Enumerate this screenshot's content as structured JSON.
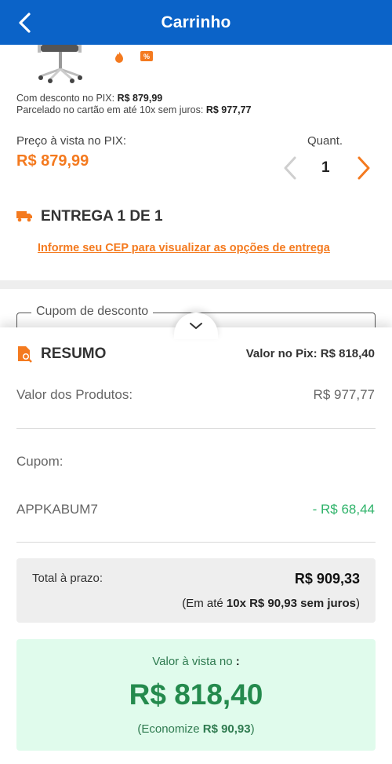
{
  "header": {
    "title": "Carrinho"
  },
  "product": {
    "pix_discount_label": "Com desconto no PIX:",
    "pix_discount_value": "R$ 879,99",
    "installment_label": "Parcelado no cartão em até 10x sem juros:",
    "installment_value": "R$ 977,77",
    "price_label": "Preço à vista no PIX:",
    "price_value": "R$ 879,99",
    "quantity_label": "Quant.",
    "quantity_value": "1"
  },
  "delivery": {
    "title": "ENTREGA 1 DE 1",
    "cep_link": "Informe seu CEP para visualizar as opções de entrega"
  },
  "coupon": {
    "legend": "Cupom de desconto"
  },
  "summary": {
    "title": "RESUMO",
    "pix_value_label": "Valor no Pix:",
    "pix_value": "R$ 818,40",
    "products_label": "Valor dos Produtos:",
    "products_value": "R$ 977,77",
    "coupon_label": "Cupom:",
    "coupon_code": "APPKABUM7",
    "coupon_discount": "- R$ 68,44",
    "total_label": "Total à prazo:",
    "total_value": "R$ 909,33",
    "installment_prefix": "(Em até",
    "installment_bold": "10x R$ 90,93 sem juros",
    "installment_suffix": ")",
    "pix_caption": "Valor à vista no",
    "pix_caption_bold": ":",
    "pix_big": "R$ 818,40",
    "save_prefix": "(Economize",
    "save_value": "R$ 90,93",
    "save_suffix": ")"
  },
  "colors": {
    "brand_blue": "#0b63c8",
    "accent_orange": "#f47a1f",
    "discount_green": "#2fb36a",
    "pix_green": "#248a4d"
  }
}
